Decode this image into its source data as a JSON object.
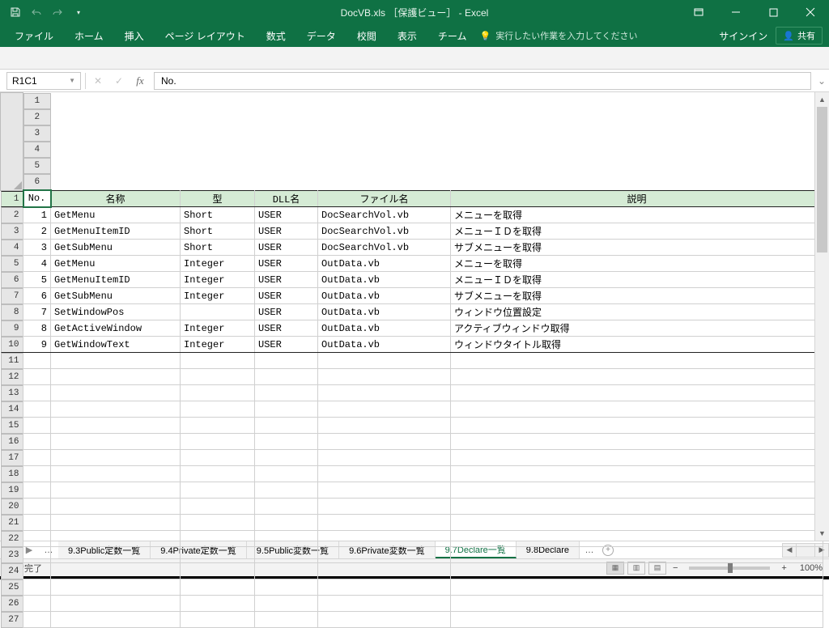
{
  "titlebar": {
    "title": "DocVB.xls ［保護ビュー］ - Excel"
  },
  "ribbon": {
    "tabs": [
      "ファイル",
      "ホーム",
      "挿入",
      "ページ レイアウト",
      "数式",
      "データ",
      "校閲",
      "表示",
      "チーム"
    ],
    "tellme": "実行したい作業を入力してください",
    "signin": "サインイン",
    "share": "共有"
  },
  "formula": {
    "namebox": "R1C1",
    "value": "No."
  },
  "columns": {
    "labels": [
      "1",
      "2",
      "3",
      "4",
      "5",
      "6"
    ],
    "widths": [
      34,
      160,
      92,
      78,
      164,
      460
    ]
  },
  "headers": [
    "No.",
    "名称",
    "型",
    "DLL名",
    "ファイル名",
    "説明"
  ],
  "rows": [
    {
      "no": "1",
      "name": "GetMenu",
      "type": "Short",
      "dll": "USER",
      "file": "DocSearchVol.vb",
      "desc": "メニューを取得"
    },
    {
      "no": "2",
      "name": "GetMenuItemID",
      "type": "Short",
      "dll": "USER",
      "file": "DocSearchVol.vb",
      "desc": "メニューＩＤを取得"
    },
    {
      "no": "3",
      "name": "GetSubMenu",
      "type": "Short",
      "dll": "USER",
      "file": "DocSearchVol.vb",
      "desc": "サブメニューを取得"
    },
    {
      "no": "4",
      "name": "GetMenu",
      "type": "Integer",
      "dll": "USER",
      "file": "OutData.vb",
      "desc": "メニューを取得"
    },
    {
      "no": "5",
      "name": "GetMenuItemID",
      "type": "Integer",
      "dll": "USER",
      "file": "OutData.vb",
      "desc": "メニューＩＤを取得"
    },
    {
      "no": "6",
      "name": "GetSubMenu",
      "type": "Integer",
      "dll": "USER",
      "file": "OutData.vb",
      "desc": "サブメニューを取得"
    },
    {
      "no": "7",
      "name": "SetWindowPos",
      "type": "",
      "dll": "USER",
      "file": "OutData.vb",
      "desc": "ウィンドウ位置設定"
    },
    {
      "no": "8",
      "name": "GetActiveWindow",
      "type": "Integer",
      "dll": "USER",
      "file": "OutData.vb",
      "desc": "アクティブウィンドウ取得"
    },
    {
      "no": "9",
      "name": "GetWindowText",
      "type": "Integer",
      "dll": "USER",
      "file": "OutData.vb",
      "desc": "ウィンドウタイトル取得"
    }
  ],
  "empty_row_count": 17,
  "sheets": {
    "tabs": [
      "9.3Public定数一覧",
      "9.4Private定数一覧",
      "9.5Public変数一覧",
      "9.6Private変数一覧",
      "9.7Declare一覧",
      "9.8Declare"
    ],
    "active_index": 4
  },
  "status": {
    "ready": "準備完了",
    "zoom": "100%"
  }
}
